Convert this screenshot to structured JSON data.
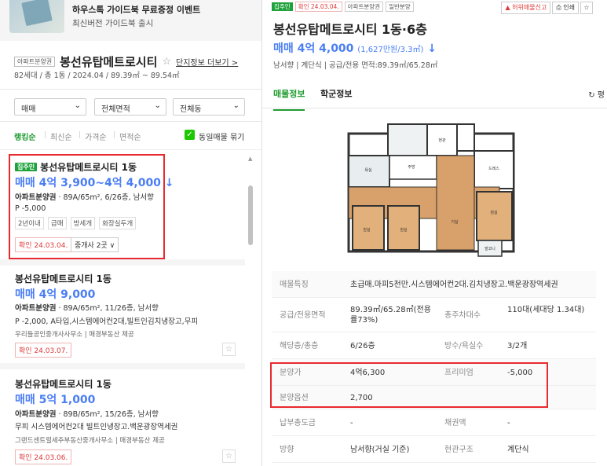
{
  "ad": {
    "title": "하우스톡 가이드북 무료증정 이벤트",
    "subtitle": "최신버전 가이드북 출시"
  },
  "complex": {
    "tag": "아파트분양권",
    "name": "봉선유탑메트로시티",
    "more_link": "단지정보 더보기 >",
    "info": "82세대 / 총 1동 / 2024.04 / 89.39㎡ ~ 89.54㎡"
  },
  "filters": {
    "trade": "매매",
    "area": "전체면적",
    "building": "전체동"
  },
  "sorts": [
    "랭킹순",
    "최신순",
    "가격순",
    "면적순"
  ],
  "same_listing_label": "동일매물 묶기",
  "listings": [
    {
      "tag": "집주인",
      "title": "봉선유탑메트로시티 1동",
      "price": "매매 4억 3,900~4억 4,000",
      "price_down": "↓",
      "line1_strong": "아파트분양권",
      "line1": " · 89A/65m², 6/26층, 남서향",
      "line2": "P -5,000",
      "chips": [
        "2년이내",
        "급매",
        "방세개",
        "화장실두개"
      ],
      "confirm": "확인 24.03.04.",
      "broker": "중개사 2곳 ∨"
    },
    {
      "title": "봉선유탑메트로시티 1동",
      "price": "매매 4억 9,000",
      "line1_strong": "아파트분양권",
      "line1": " · 89A/65m², 11/26층, 남서향",
      "line2": "P -2,000, A타입,시스템에어컨2대,빌트인김치냉장고,무피",
      "small": "우리들공인중개사사무소 | 매경부동산 제공",
      "confirm": "확인 24.03.07."
    },
    {
      "title": "봉선유탑메트로시티 1동",
      "price": "매매 5억 1,000",
      "line1_strong": "아파트분양권",
      "line1": " · 89B/65m², 15/26층, 남서향",
      "line2": "무피 시스템에어컨2대 빌트인냉장고.백운광장역세권",
      "small": "그랜드센트럴세주부동산중개사무소 | 매경부동산 제공",
      "confirm": "확인 24.03.06."
    }
  ],
  "detail": {
    "tags": [
      "집주인",
      "확인 24.03.04.",
      "아파트분양권",
      "일반분양"
    ],
    "buttons": [
      "허위매물신고",
      "인쇄"
    ],
    "title": "봉선유탑메트로시티 1동·6층",
    "price": "매매 4억 4,000",
    "price_sub": "(1,627만원/3.3㎡)",
    "price_down": "↓",
    "meta": "남서향 | 계단식 | 공급/전용 면적:89.39㎡/65.28㎡",
    "tabs": [
      "매물정보",
      "학군정보"
    ],
    "refresh": "평",
    "plan_labels": [
      "침실",
      "침실",
      "침실",
      "거실",
      "주방",
      "욕실",
      "드레스",
      "발코니",
      "현관"
    ],
    "table": [
      {
        "k1": "매물특징",
        "v1": "초급매.마피5천만.시스템에어컨2대.김치냉장고.백운광장역세권"
      },
      {
        "k1": "공급/전용면적",
        "v1": "89.39㎡/65.28㎡(전용률73%)",
        "k2": "총주차대수",
        "v2": "110대(세대당 1.34대)"
      },
      {
        "k1": "해당층/총층",
        "v1": "6/26층",
        "k2": "방수/욕실수",
        "v2": "3/2개"
      },
      {
        "k1": "분양가",
        "v1": "4억6,300",
        "k2": "프리미엄",
        "v2": "-5,000"
      },
      {
        "k1": "분양옵션",
        "v1": "2,700"
      },
      {
        "k1": "납부총도금",
        "v1": "-",
        "k2": "채권액",
        "v2": "-"
      },
      {
        "k1": "방향",
        "v1": "남서향(거실 기준)",
        "k2": "현관구조",
        "v2": "계단식"
      }
    ]
  }
}
